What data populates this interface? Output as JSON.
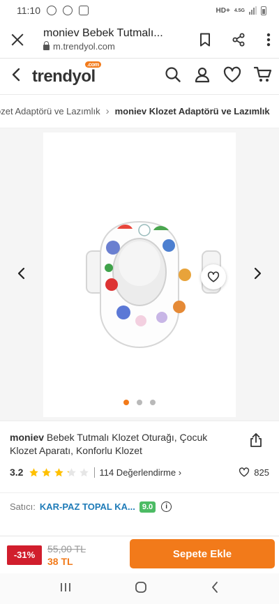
{
  "status": {
    "time": "11:10",
    "network": "HD+",
    "net_type": "4.5G"
  },
  "browser": {
    "page_title": "moniev Bebek Tutmalı...",
    "host": "m.trendyol.com"
  },
  "site": {
    "logo": "trendyol",
    "logo_badge": ".com"
  },
  "breadcrumb": {
    "parent": "ozet Adaptörü ve Lazımlık",
    "current": "moniev Klozet Adaptörü ve Lazımlık"
  },
  "gallery": {
    "image_count": 3,
    "active_index": 0
  },
  "product": {
    "brand": "moniev",
    "name": " Bebek Tutmalı Klozet Oturağı, Çocuk Klozet Aparatı, Konforlu Klozet",
    "rating": "3.2",
    "rating_value": 3.2,
    "reviews": "114 Değerlendirme",
    "likes": "825"
  },
  "seller": {
    "label": "Satıcı:",
    "name": "KAR-PAZ TOPAL KA...",
    "score": "9.0",
    "info_icon": "i"
  },
  "buy": {
    "discount": "-31%",
    "old_price": "55,00 TL",
    "new_price": "38 TL",
    "add_label": "Sepete Ekle"
  },
  "colors": {
    "accent": "#f27a1a",
    "discount": "#d11e2d",
    "seller_link": "#1e7bb8",
    "score": "#4cbb64"
  }
}
